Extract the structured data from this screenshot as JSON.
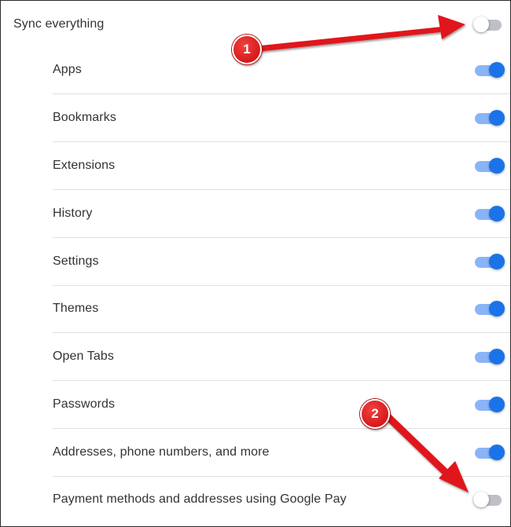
{
  "sync_everything": {
    "label": "Sync everything",
    "enabled": false
  },
  "items": [
    {
      "label": "Apps",
      "enabled": true
    },
    {
      "label": "Bookmarks",
      "enabled": true
    },
    {
      "label": "Extensions",
      "enabled": true
    },
    {
      "label": "History",
      "enabled": true
    },
    {
      "label": "Settings",
      "enabled": true
    },
    {
      "label": "Themes",
      "enabled": true
    },
    {
      "label": "Open Tabs",
      "enabled": true
    },
    {
      "label": "Passwords",
      "enabled": true
    },
    {
      "label": "Addresses, phone numbers, and more",
      "enabled": true
    },
    {
      "label": "Payment methods and addresses using Google Pay",
      "enabled": false
    }
  ],
  "annotations": [
    {
      "number": "1"
    },
    {
      "number": "2"
    }
  ],
  "colors": {
    "toggle_on_track": "#8ab4f8",
    "toggle_on_knob": "#1a73e8",
    "toggle_off_track": "#bdc1c6",
    "toggle_off_knob": "#ffffff",
    "annotation_red": "#e0191d",
    "divider": "#e0e0e0"
  }
}
